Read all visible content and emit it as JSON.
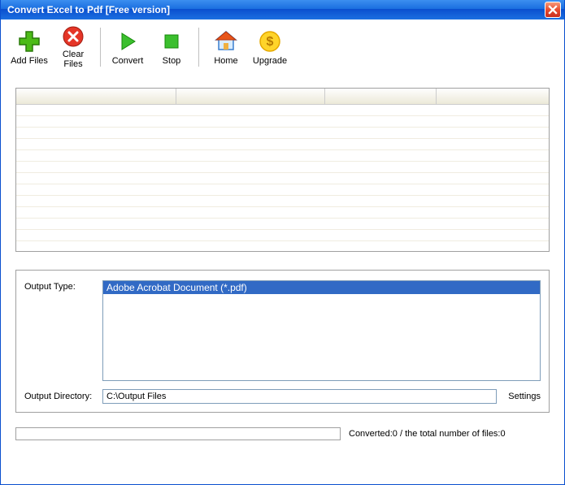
{
  "window": {
    "title": "Convert Excel to Pdf [Free version]"
  },
  "toolbar": {
    "add_files": "Add Files",
    "clear_files": "Clear Files",
    "convert": "Convert",
    "stop": "Stop",
    "home": "Home",
    "upgrade": "Upgrade"
  },
  "output": {
    "type_label": "Output Type:",
    "type_selected": "Adobe Acrobat Document (*.pdf)",
    "dir_label": "Output Directory:",
    "dir_value": "C:\\Output Files",
    "settings": "Settings"
  },
  "status": {
    "text": "Converted:0  /  the total number of files:0"
  }
}
